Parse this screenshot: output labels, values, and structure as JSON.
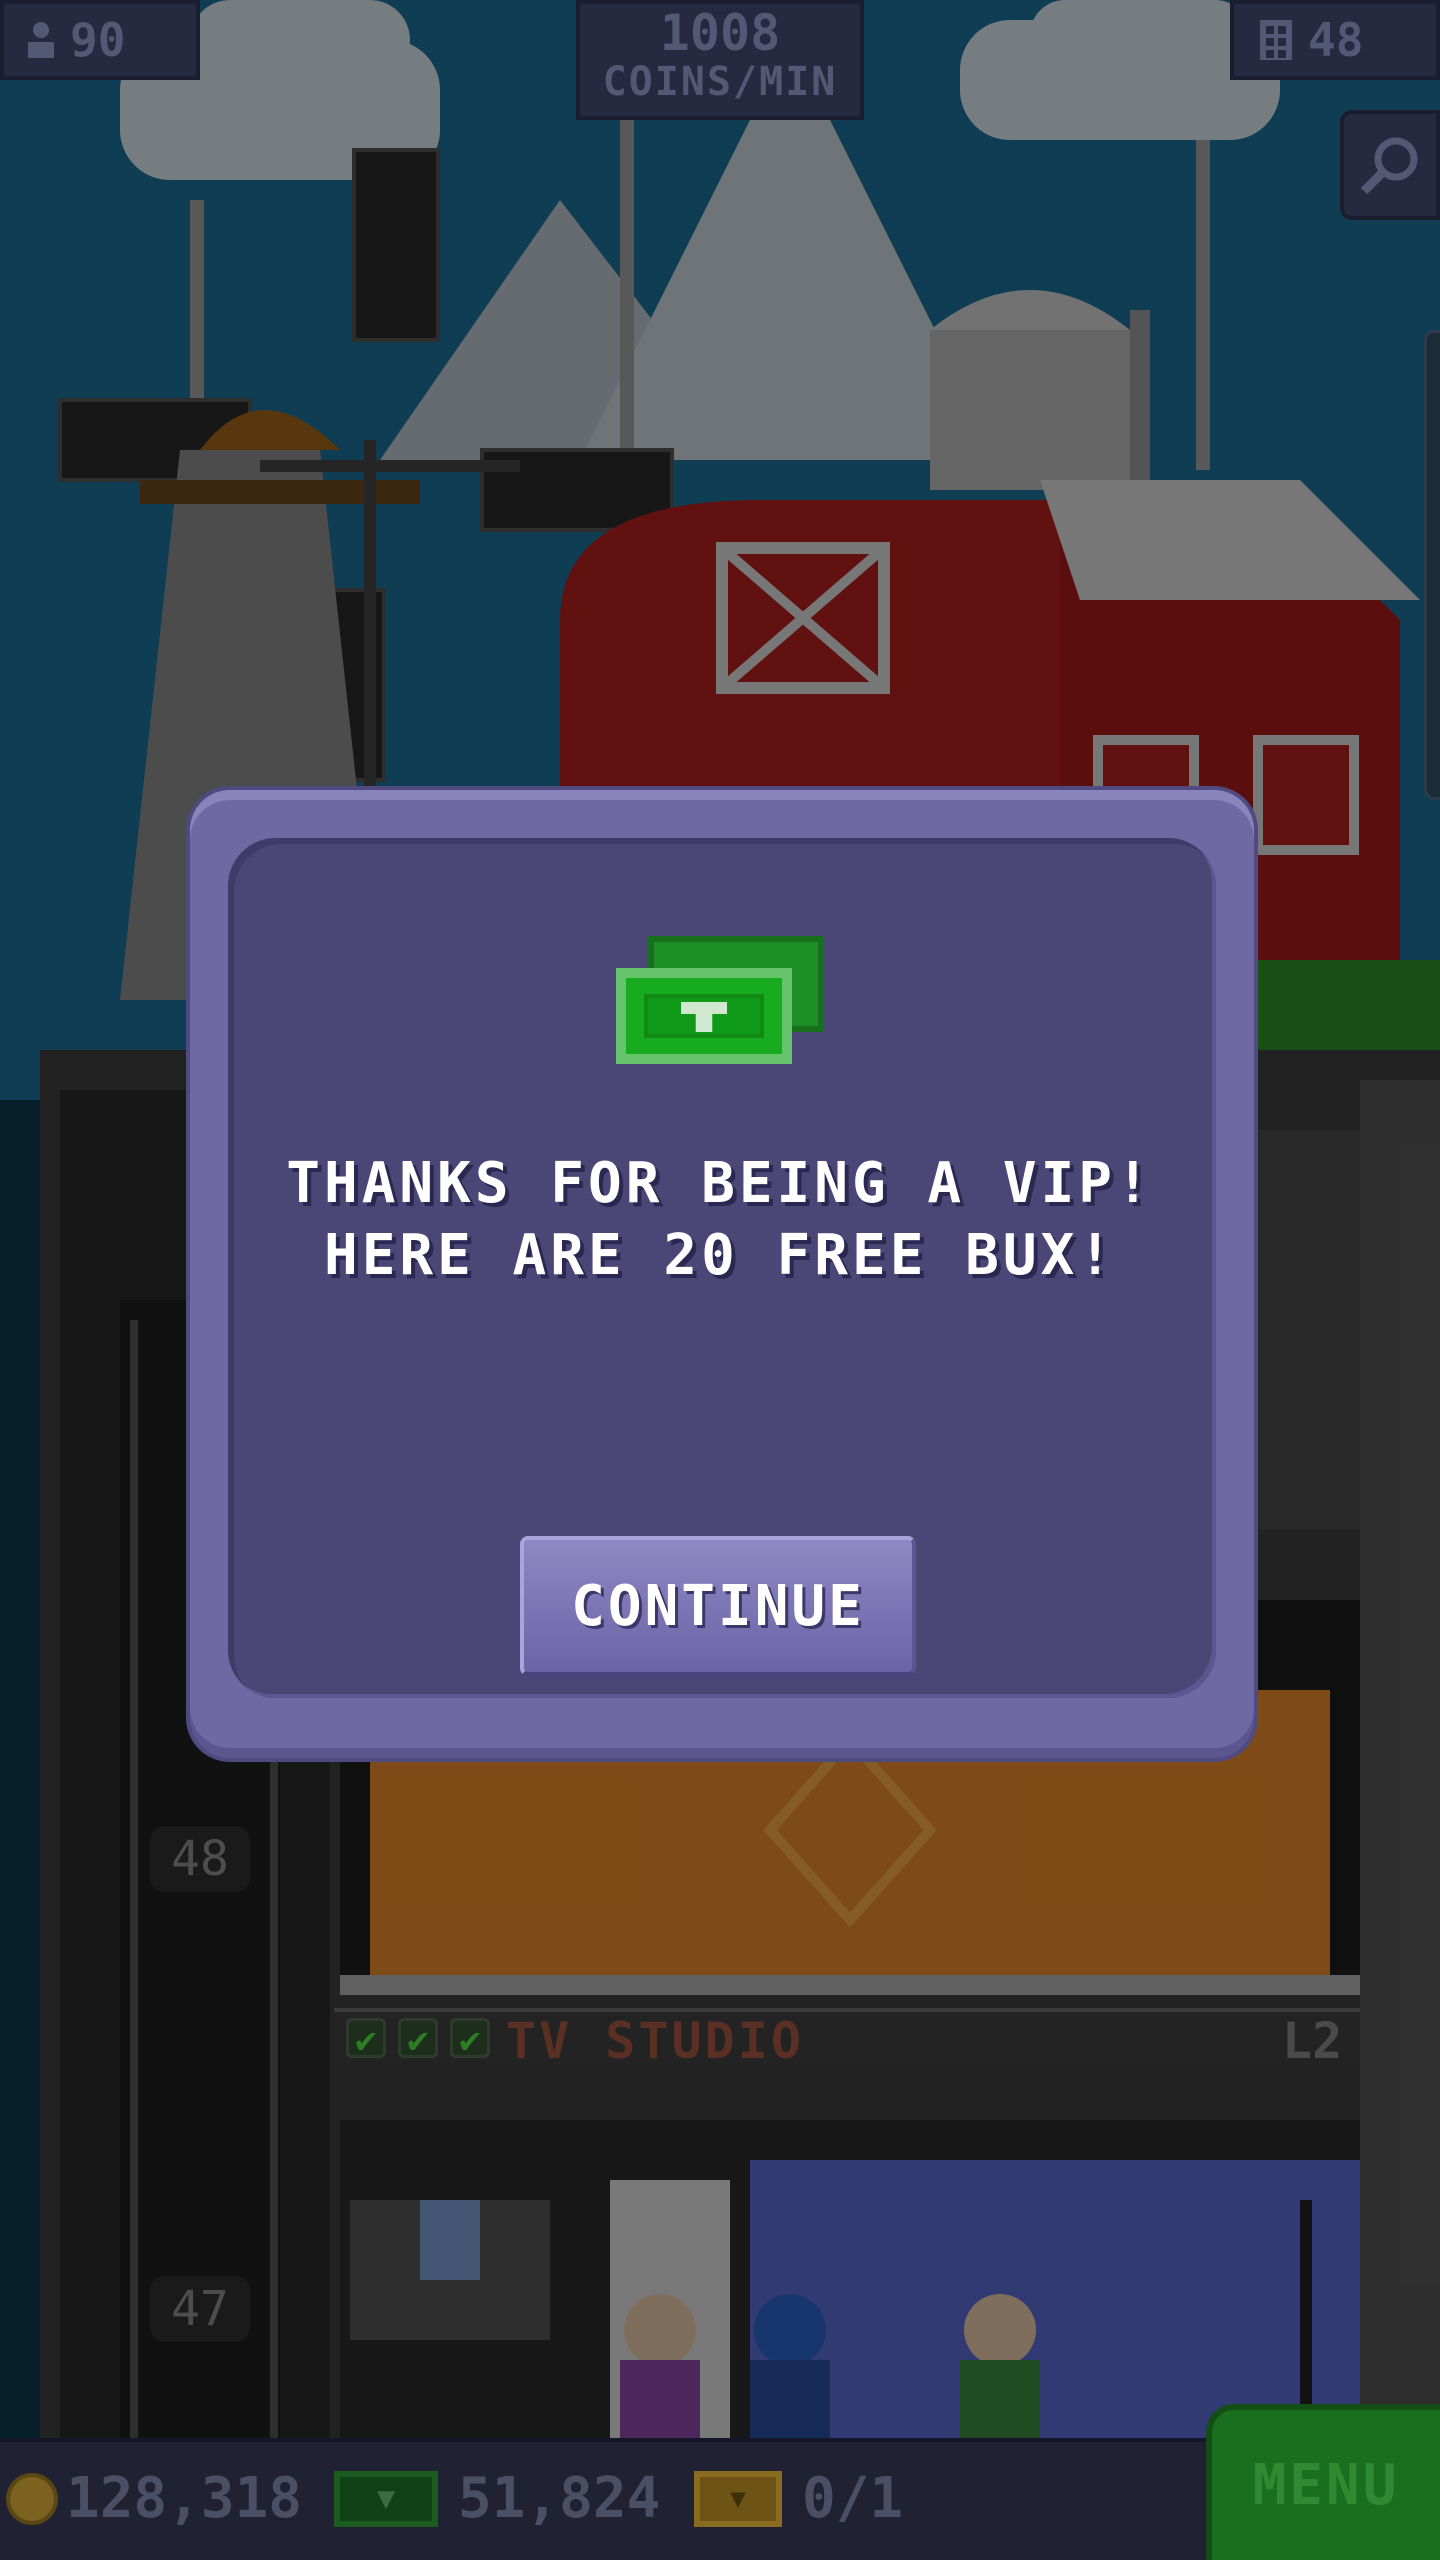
{
  "hud": {
    "population": "90",
    "coins_per_min_value": "1008",
    "coins_per_min_label": "COINS/MIN",
    "floors": "48"
  },
  "tower": {
    "floor_numbers": [
      "48",
      "47"
    ],
    "floor_name": "TV STUDIO",
    "floor_level": "L2"
  },
  "dialog": {
    "message_line1": "THANKS FOR BEING A VIP!",
    "message_line2": "HERE ARE 20 FREE BUX!",
    "continue_label": "CONTINUE"
  },
  "bottom_bar": {
    "coins": "128,318",
    "bux": "51,824",
    "tickets": "0/1",
    "menu_label": "MENU"
  },
  "colors": {
    "dialog_bg": "#6e68a3",
    "dialog_inner": "#4a4676",
    "bux_green": "#17ab20",
    "menu_green": "#1a6f1e",
    "barn_red": "#b21f1f"
  }
}
